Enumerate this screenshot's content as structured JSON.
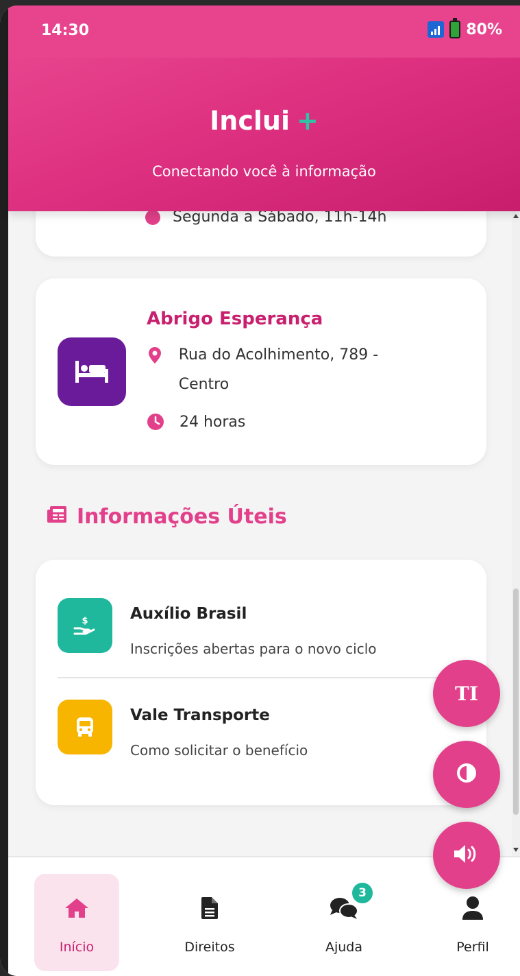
{
  "status_bar": {
    "time": "14:30",
    "battery": "80%"
  },
  "header": {
    "title": "Inclui",
    "title_accent": "+",
    "subtitle": "Conectando você à informação"
  },
  "partial_card": {
    "schedule": "Segunda a Sábado, 11h-14h"
  },
  "shelter_card": {
    "name": "Abrigo Esperança",
    "address": "Rua do Acolhimento, 789 - Centro",
    "hours": "24 horas"
  },
  "info_section": {
    "title": "Informações Úteis",
    "items": [
      {
        "title": "Auxílio Brasil",
        "description": "Inscrições abertas para o novo ciclo",
        "icon": "hand-money-icon",
        "color": "#1fb89c"
      },
      {
        "title": "Vale Transporte",
        "description": "Como solicitar o benefício",
        "icon": "bus-icon",
        "color": "#f7b500"
      }
    ]
  },
  "fabs": [
    {
      "icon": "text-size-icon",
      "label": "TI"
    },
    {
      "icon": "contrast-icon"
    },
    {
      "icon": "speaker-icon"
    }
  ],
  "bottom_nav": {
    "items": [
      {
        "label": "Início",
        "icon": "home-icon",
        "active": true
      },
      {
        "label": "Direitos",
        "icon": "document-icon"
      },
      {
        "label": "Ajuda",
        "icon": "chat-icon",
        "badge": "3"
      },
      {
        "label": "Perfil",
        "icon": "user-icon"
      }
    ]
  },
  "colors": {
    "primary": "#e2408a",
    "primary_dark": "#c8206e",
    "accent": "#1fb89c",
    "shelter": "#6a1b9a",
    "transport": "#f7b500"
  }
}
